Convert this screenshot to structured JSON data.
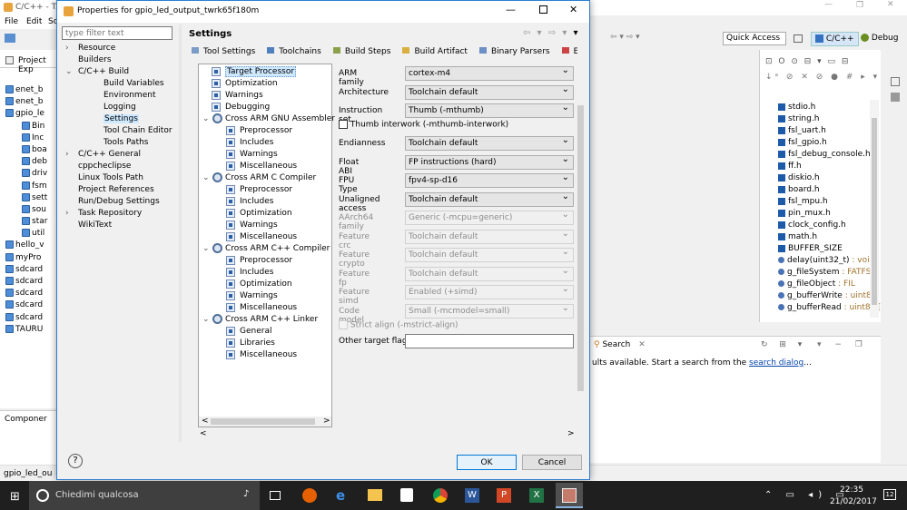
{
  "ide": {
    "title": "C/C++ - TA",
    "menu": [
      "File",
      "Edit",
      "So"
    ],
    "quick_access": "Quick Access",
    "perspective_cpp": "C/C++",
    "perspective_debug": "Debug",
    "project_explorer": "Project Exp",
    "component": "Componer",
    "status": "gpio_led_ou"
  },
  "ide_tree": [
    "enet_b",
    "enet_b",
    "gpio_le",
    "Bin",
    "Inc",
    "boa",
    "deb",
    "driv",
    "fsm",
    "sett",
    "sou",
    "star",
    "util",
    "hello_v",
    "myPro",
    "sdcard",
    "sdcard",
    "sdcard",
    "sdcard",
    "sdcard",
    "TAURU"
  ],
  "outline": [
    "stdio.h",
    "string.h",
    "fsl_uart.h",
    "fsl_gpio.h",
    "fsl_debug_console.h",
    "ff.h",
    "diskio.h",
    "board.h",
    "fsl_mpu.h",
    "pin_mux.h",
    "clock_config.h",
    "math.h",
    "BUFFER_SIZE"
  ],
  "outline_typed": [
    {
      "name": "delay(uint32_t)",
      "type": " : void"
    },
    {
      "name": "g_fileSystem",
      "type": " : FATFS"
    },
    {
      "name": "g_fileObject",
      "type": " : FIL"
    },
    {
      "name": "g_bufferWrite",
      "type": " : uint8_t"
    },
    {
      "name": "g_bufferRead",
      "type": " : uint8_t["
    }
  ],
  "search": {
    "tab": "Search",
    "text": "ults available. Start a search from the ",
    "link": "search dialog",
    "end": "..."
  },
  "dialog": {
    "title": "Properties for gpio_led_output_twrk65f180m",
    "filter_placeholder": "type filter text",
    "heading": "Settings",
    "ok": "OK",
    "cancel": "Cancel"
  },
  "left_tree": [
    {
      "label": "Resource",
      "d": 0,
      "exp": false
    },
    {
      "label": "Builders",
      "d": 0,
      "exp": null
    },
    {
      "label": "C/C++ Build",
      "d": 0,
      "exp": true
    },
    {
      "label": "Build Variables",
      "d": 1,
      "exp": null
    },
    {
      "label": "Environment",
      "d": 1,
      "exp": null
    },
    {
      "label": "Logging",
      "d": 1,
      "exp": null
    },
    {
      "label": "Settings",
      "d": 1,
      "exp": null,
      "sel": true
    },
    {
      "label": "Tool Chain Editor",
      "d": 1,
      "exp": null
    },
    {
      "label": "Tools Paths",
      "d": 1,
      "exp": null
    },
    {
      "label": "C/C++ General",
      "d": 0,
      "exp": false
    },
    {
      "label": "cppcheclipse",
      "d": 0,
      "exp": null
    },
    {
      "label": "Linux Tools Path",
      "d": 0,
      "exp": null
    },
    {
      "label": "Project References",
      "d": 0,
      "exp": null
    },
    {
      "label": "Run/Debug Settings",
      "d": 0,
      "exp": null
    },
    {
      "label": "Task Repository",
      "d": 0,
      "exp": false
    },
    {
      "label": "WikiText",
      "d": 0,
      "exp": null
    }
  ],
  "tabs": [
    "Tool Settings",
    "Toolchains",
    "Build Steps",
    "Build Artifact",
    "Binary Parsers",
    "Error Parser"
  ],
  "tool_tree": [
    {
      "label": "Target Processor",
      "d": 1,
      "t": "p",
      "sel": true
    },
    {
      "label": "Optimization",
      "d": 1,
      "t": "p"
    },
    {
      "label": "Warnings",
      "d": 1,
      "t": "p"
    },
    {
      "label": "Debugging",
      "d": 1,
      "t": "p"
    },
    {
      "label": "Cross ARM GNU Assembler",
      "d": 0,
      "t": "g"
    },
    {
      "label": "Preprocessor",
      "d": 2,
      "t": "p"
    },
    {
      "label": "Includes",
      "d": 2,
      "t": "p"
    },
    {
      "label": "Warnings",
      "d": 2,
      "t": "p"
    },
    {
      "label": "Miscellaneous",
      "d": 2,
      "t": "p"
    },
    {
      "label": "Cross ARM C Compiler",
      "d": 0,
      "t": "g"
    },
    {
      "label": "Preprocessor",
      "d": 2,
      "t": "p"
    },
    {
      "label": "Includes",
      "d": 2,
      "t": "p"
    },
    {
      "label": "Optimization",
      "d": 2,
      "t": "p"
    },
    {
      "label": "Warnings",
      "d": 2,
      "t": "p"
    },
    {
      "label": "Miscellaneous",
      "d": 2,
      "t": "p"
    },
    {
      "label": "Cross ARM C++ Compiler",
      "d": 0,
      "t": "g"
    },
    {
      "label": "Preprocessor",
      "d": 2,
      "t": "p"
    },
    {
      "label": "Includes",
      "d": 2,
      "t": "p"
    },
    {
      "label": "Optimization",
      "d": 2,
      "t": "p"
    },
    {
      "label": "Warnings",
      "d": 2,
      "t": "p"
    },
    {
      "label": "Miscellaneous",
      "d": 2,
      "t": "p"
    },
    {
      "label": "Cross ARM C++ Linker",
      "d": 0,
      "t": "g"
    },
    {
      "label": "General",
      "d": 2,
      "t": "p"
    },
    {
      "label": "Libraries",
      "d": 2,
      "t": "p"
    },
    {
      "label": "Miscellaneous",
      "d": 2,
      "t": "p"
    }
  ],
  "fields": [
    {
      "label": "ARM family",
      "value": "cortex-m4",
      "en": true
    },
    {
      "label": "Architecture",
      "value": "Toolchain default",
      "en": true
    },
    {
      "label": "Instruction set",
      "value": "Thumb (-mthumb)",
      "en": true
    },
    {
      "label": "Endianness",
      "value": "Toolchain default",
      "en": true
    },
    {
      "label": "Float ABI",
      "value": "FP instructions (hard)",
      "en": true
    },
    {
      "label": "FPU Type",
      "value": "fpv4-sp-d16",
      "en": true
    },
    {
      "label": "Unaligned access",
      "value": "Toolchain default",
      "en": true
    },
    {
      "label": "AArch64 family",
      "value": "Generic (-mcpu=generic)",
      "en": false
    },
    {
      "label": "Feature crc",
      "value": "Toolchain default",
      "en": false
    },
    {
      "label": "Feature crypto",
      "value": "Toolchain default",
      "en": false
    },
    {
      "label": "Feature fp",
      "value": "Toolchain default",
      "en": false
    },
    {
      "label": "Feature simd",
      "value": "Enabled (+simd)",
      "en": false
    },
    {
      "label": "Code model",
      "value": "Small (-mcmodel=small)",
      "en": false
    }
  ],
  "thumb_interwork": "Thumb interwork (-mthumb-interwork)",
  "strict_align": "Strict align (-mstrict-align)",
  "other_flags": "Other target flags",
  "taskbar": {
    "search": "Chiedimi qualcosa",
    "time": "22:35",
    "date": "21/02/2017",
    "notif": "12"
  }
}
